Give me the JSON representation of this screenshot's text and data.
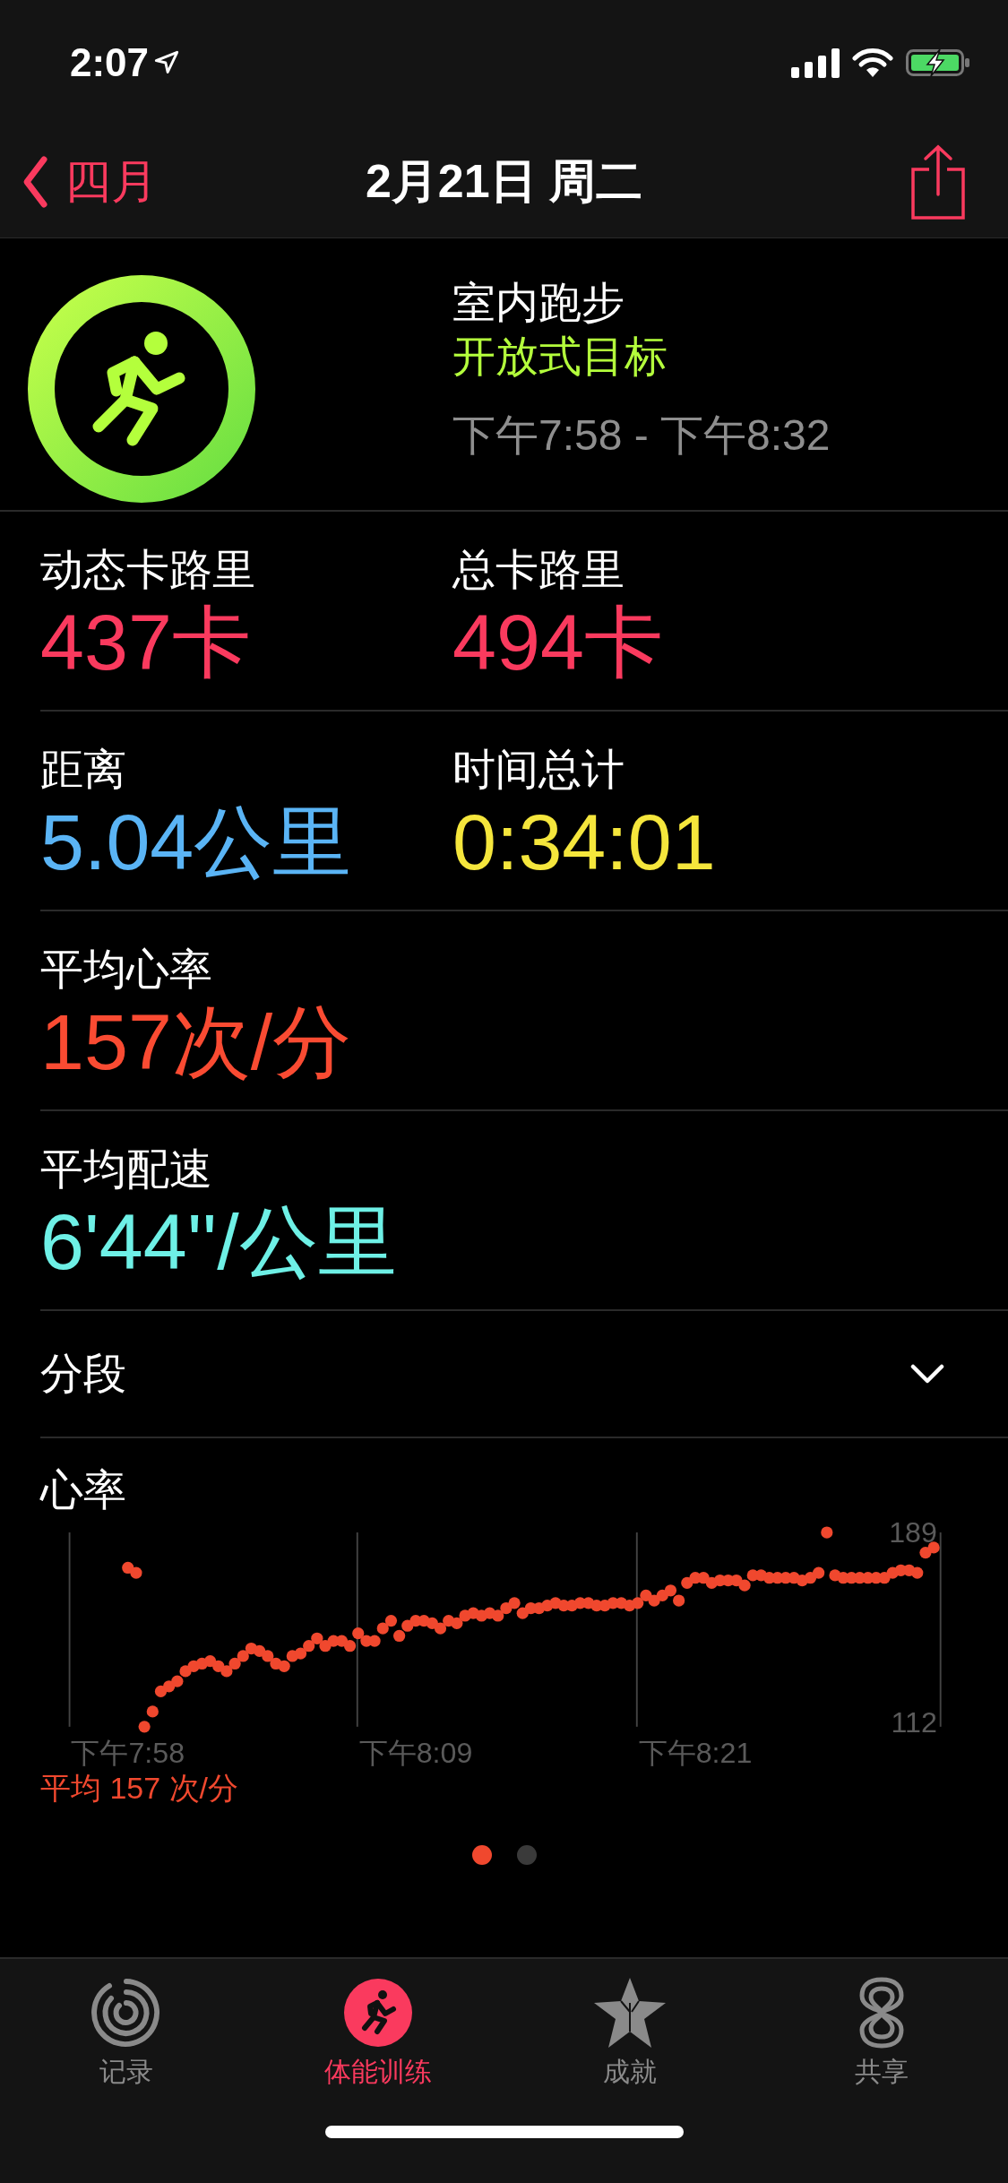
{
  "status_bar": {
    "time": "2:07"
  },
  "nav": {
    "back": "四月",
    "title": "2月21日 周二"
  },
  "workout": {
    "name": "室内跑步",
    "goal": "开放式目标",
    "time_range": "下午7:58 - 下午8:32"
  },
  "metrics": [
    [
      {
        "label": "动态卡路里",
        "value": "437卡",
        "color": "#fa3a5e"
      },
      {
        "label": "总卡路里",
        "value": "494卡",
        "color": "#fa3a5e"
      }
    ],
    [
      {
        "label": "距离",
        "value": "5.04公里",
        "color": "#5ab4f5"
      },
      {
        "label": "时间总计",
        "value": "0:34:01",
        "color": "#f5e63c"
      }
    ],
    [
      {
        "label": "平均心率",
        "value": "157次/分",
        "color": "#fa4b32"
      }
    ],
    [
      {
        "label": "平均配速",
        "value": "6'44''/公里",
        "color": "#6ef0e6"
      }
    ]
  ],
  "splits": {
    "label": "分段",
    "expanded": false
  },
  "heart_rate": {
    "average": "平均 157 次/分",
    "chart_data": {
      "type": "scatter",
      "title": "心率",
      "ylim": [
        112,
        189
      ],
      "categories": [
        "下午7:58",
        null,
        null,
        null,
        null,
        null,
        null,
        null,
        null,
        null,
        null,
        null,
        null,
        null,
        null,
        null,
        null,
        null,
        null,
        null,
        null,
        null,
        null,
        null,
        null,
        null,
        null,
        null,
        null,
        null,
        null,
        null,
        null,
        null,
        null,
        "下午8:09",
        null,
        null,
        null,
        null,
        null,
        null,
        null,
        null,
        null,
        null,
        null,
        null,
        null,
        null,
        null,
        null,
        null,
        null,
        null,
        null,
        null,
        null,
        null,
        null,
        null,
        null,
        null,
        null,
        null,
        null,
        null,
        null,
        null,
        "下午8:21",
        null,
        null,
        null,
        null,
        null,
        null,
        null,
        null,
        null,
        null,
        null,
        null,
        null,
        null,
        null,
        null,
        null,
        null,
        null,
        null,
        null,
        null,
        null,
        null,
        null,
        null,
        null,
        null,
        null
      ],
      "yticks": [
        189,
        112
      ],
      "series": [
        {
          "color": "#f0482e",
          "values": [
            175,
            173,
            112,
            118,
            126,
            128,
            130,
            134,
            136,
            137,
            138,
            136,
            134,
            137,
            140,
            143,
            142,
            140,
            137,
            136,
            140,
            141,
            144,
            147,
            144,
            146,
            146,
            144,
            149,
            146,
            146,
            151,
            154,
            148,
            152,
            154,
            154,
            153,
            151,
            154,
            153,
            156,
            157,
            156,
            157,
            156,
            159,
            161,
            157,
            159,
            159,
            160,
            161,
            160,
            160,
            161,
            161,
            160,
            160,
            161,
            161,
            160,
            161,
            164,
            162,
            164,
            166,
            162,
            169,
            171,
            171,
            169,
            170,
            170,
            170,
            168,
            172,
            172,
            171,
            171,
            171,
            171,
            170,
            171,
            173,
            189,
            172,
            171,
            171,
            171,
            171,
            171,
            171,
            173,
            174,
            174,
            173,
            181,
            183
          ]
        }
      ]
    }
  },
  "pager": [
    {
      "selected": true
    },
    {
      "selected": false
    }
  ],
  "tabs": [
    {
      "label": "记录",
      "kind": "rings",
      "selected": false
    },
    {
      "label": "体能训练",
      "kind": "runner",
      "selected": true
    },
    {
      "label": "成就",
      "kind": "star",
      "selected": false
    },
    {
      "label": "共享",
      "kind": "share",
      "selected": false
    }
  ]
}
